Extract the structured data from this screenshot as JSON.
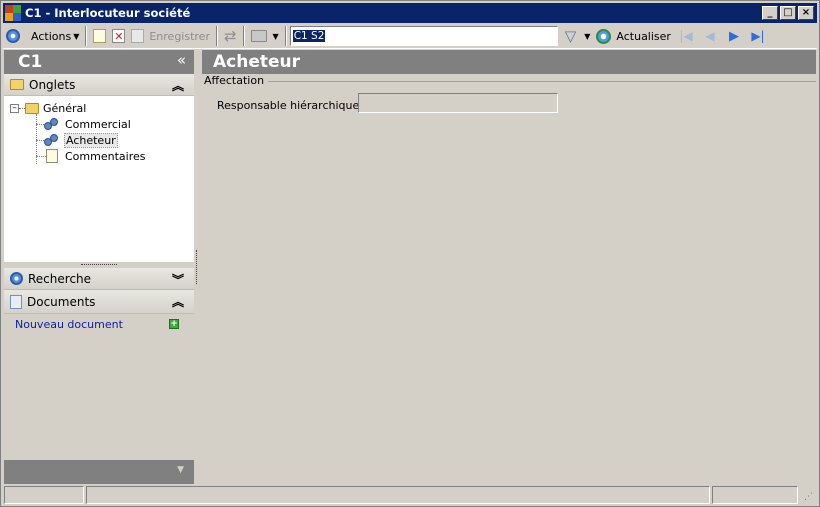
{
  "window": {
    "title": "C1 - Interlocuteur société"
  },
  "toolbar": {
    "actions_label": "Actions",
    "save_label": "Enregistrer",
    "record_value": "C1 S2",
    "refresh_label": "Actualiser"
  },
  "left_panel": {
    "header": "C1",
    "onglets_label": "Onglets",
    "tree": {
      "root": "Général",
      "items": [
        "Commercial",
        "Acheteur",
        "Commentaires"
      ],
      "selected": "Acheteur"
    },
    "recherche_label": "Recherche",
    "documents_label": "Documents",
    "new_document_label": "Nouveau document"
  },
  "main": {
    "header": "Acheteur",
    "group_title": "Affectation",
    "field_label": "Responsable hiérarchique :",
    "field_value": ""
  },
  "colors": {
    "titlebar": "#0a246a",
    "panel_header": "#808080",
    "background": "#d4d0c8"
  },
  "icons": [
    "app-icon",
    "minimize-icon",
    "maximize-icon",
    "close-icon",
    "actions-icon",
    "new-icon",
    "delete-icon",
    "save-icon",
    "sync-icon",
    "print-icon",
    "filter-icon",
    "refresh-icon",
    "first-icon",
    "previous-icon",
    "next-icon",
    "last-icon",
    "folder-icon",
    "people-icon",
    "document-icon",
    "search-icon",
    "add-icon"
  ]
}
